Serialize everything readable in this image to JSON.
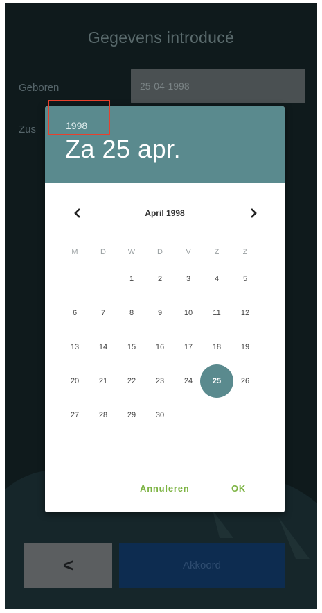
{
  "page": {
    "title": "Gegevens introducé"
  },
  "form": {
    "geboren_label": "Geboren",
    "geboren_value": "25-04-1998",
    "zus_label": "Zus"
  },
  "datepicker": {
    "year": "1998",
    "selected_date": "Za 25 apr.",
    "month_label": "April 1998",
    "prev_icon": "chevron-left-icon",
    "next_icon": "chevron-right-icon",
    "weekdays": [
      "M",
      "D",
      "W",
      "D",
      "V",
      "Z",
      "Z"
    ],
    "days": [
      "1",
      "2",
      "3",
      "4",
      "5",
      "6",
      "7",
      "8",
      "9",
      "10",
      "11",
      "12",
      "13",
      "14",
      "15",
      "16",
      "17",
      "18",
      "19",
      "20",
      "21",
      "22",
      "23",
      "24",
      "25",
      "26",
      "27",
      "28",
      "29",
      "30"
    ],
    "selected_day": 25,
    "cancel_label": "Annuleren",
    "ok_label": "OK"
  },
  "footer": {
    "back_icon": "chevron-left-icon",
    "back_label": "<",
    "akkoord_label": "Akkoord"
  },
  "colors": {
    "header": "#5a8a8e",
    "accent_button_text": "#7cb342",
    "akkoord_bg": "#0d2c50",
    "highlight": "#e8402c"
  }
}
